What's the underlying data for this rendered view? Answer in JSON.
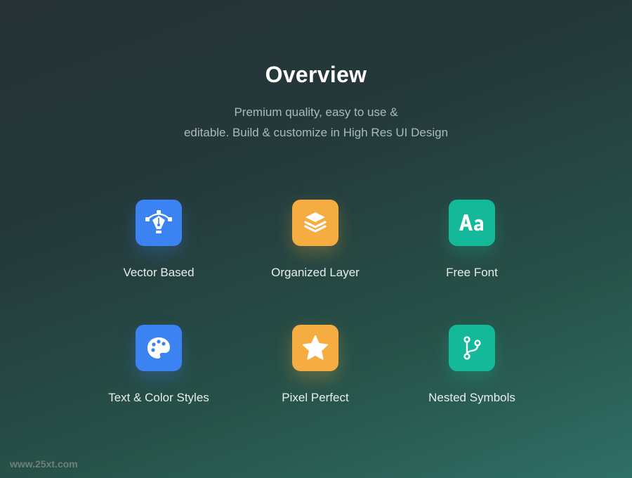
{
  "header": {
    "title": "Overview",
    "subtitle_line1": "Premium quality, easy to use &",
    "subtitle_line2": "editable. Build & customize in High Res UI Design"
  },
  "features": [
    {
      "label": "Vector Based",
      "icon": "pen-tool-icon",
      "color": "#3b82f3"
    },
    {
      "label": "Organized Layer",
      "icon": "layers-icon",
      "color": "#f5ad42"
    },
    {
      "label": "Free Font",
      "icon": "font-aa-icon",
      "color": "#14b99a"
    },
    {
      "label": "Text & Color Styles",
      "icon": "palette-icon",
      "color": "#3b82f3"
    },
    {
      "label": "Pixel Perfect",
      "icon": "star-icon",
      "color": "#f5ad42"
    },
    {
      "label": "Nested Symbols",
      "icon": "git-branch-icon",
      "color": "#14b99a"
    }
  ],
  "watermark": "www.25xt.com"
}
